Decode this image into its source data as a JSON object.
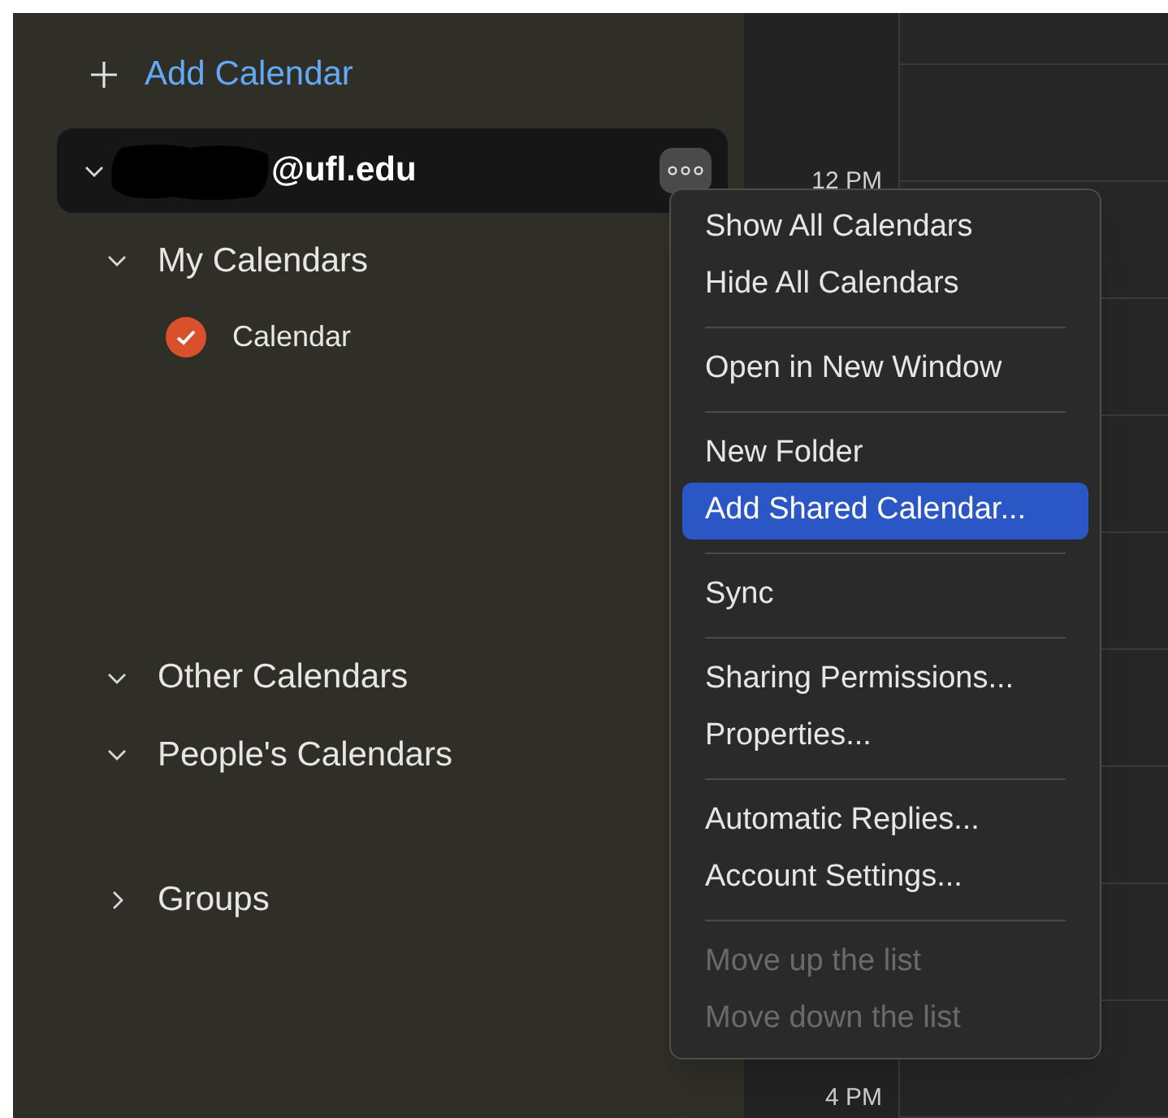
{
  "add_calendar": {
    "label": "Add Calendar"
  },
  "account": {
    "email": "@ufl.edu",
    "expanded": true
  },
  "sections": [
    {
      "label": "My Calendars",
      "expanded": true,
      "calendars": [
        {
          "name": "Calendar",
          "checked": true,
          "color": "#d9512c"
        }
      ]
    },
    {
      "label": "Other Calendars",
      "expanded": true
    },
    {
      "label": "People's Calendars",
      "expanded": true
    },
    {
      "label": "Groups",
      "expanded": false
    }
  ],
  "time_labels": [
    "12 PM",
    "4 PM"
  ],
  "context_menu": {
    "groups": [
      [
        {
          "label": "Show All Calendars",
          "selected": false,
          "disabled": false
        },
        {
          "label": "Hide All Calendars",
          "selected": false,
          "disabled": false
        }
      ],
      [
        {
          "label": "Open in New Window",
          "selected": false,
          "disabled": false
        }
      ],
      [
        {
          "label": "New Folder",
          "selected": false,
          "disabled": false
        },
        {
          "label": "Add Shared Calendar...",
          "selected": true,
          "disabled": false
        }
      ],
      [
        {
          "label": "Sync",
          "selected": false,
          "disabled": false
        }
      ],
      [
        {
          "label": "Sharing Permissions...",
          "selected": false,
          "disabled": false
        },
        {
          "label": "Properties...",
          "selected": false,
          "disabled": false
        }
      ],
      [
        {
          "label": "Automatic Replies...",
          "selected": false,
          "disabled": false
        },
        {
          "label": "Account Settings...",
          "selected": false,
          "disabled": false
        }
      ],
      [
        {
          "label": "Move up the list",
          "selected": false,
          "disabled": true
        },
        {
          "label": "Move down the list",
          "selected": false,
          "disabled": true
        }
      ]
    ]
  }
}
